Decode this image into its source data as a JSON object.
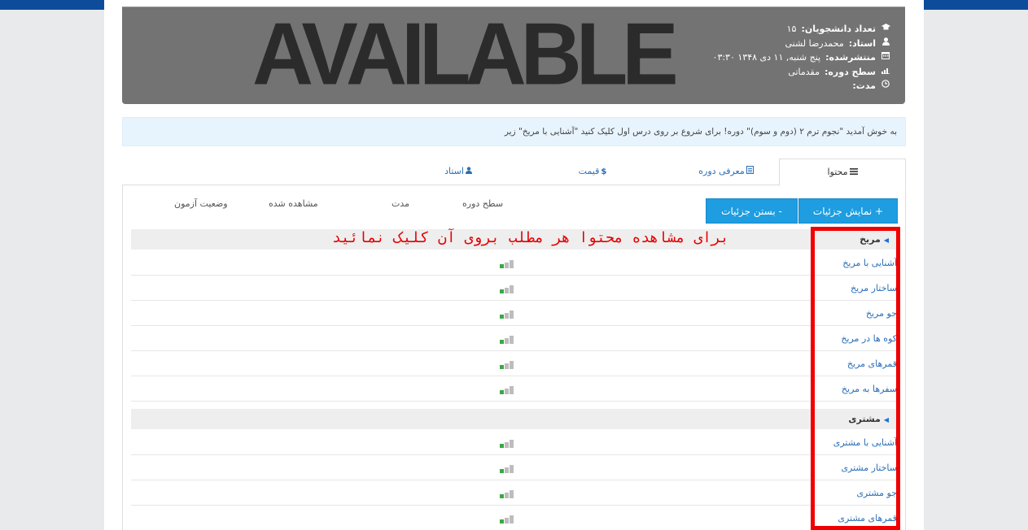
{
  "banner": {
    "image_text": "AVAILABLE",
    "info": [
      {
        "icon": "graduation-cap-icon",
        "label": "تعداد دانشجویان:",
        "value": "۱۵"
      },
      {
        "icon": "user-icon",
        "label": "استاد:",
        "value": "محمدرضا لشنی"
      },
      {
        "icon": "calendar-icon",
        "label": "منتشرشده:",
        "value": "پنج شنبه, ۱۱ دی ۱۳۴۸ ۰۳:۳۰"
      },
      {
        "icon": "level-bars-icon",
        "label": "سطح دوره:",
        "value": "مقدماتی"
      },
      {
        "icon": "clock-icon",
        "label": "مدت:",
        "value": ""
      }
    ]
  },
  "welcome_text": "به خوش آمدید \"نجوم ترم ۲ (دوم و سوم)\" دوره! برای شروع بر روی درس اول کلیک کنید \"آشنایی با مریخ\" زیر",
  "tabs": [
    {
      "label": "محتوا",
      "icon": "list-icon",
      "active": true
    },
    {
      "label": "معرفی دوره",
      "icon": "document-icon",
      "active": false
    },
    {
      "label": "قیمت",
      "icon": "dollar-icon",
      "active": false
    },
    {
      "label": "استاد",
      "icon": "user-icon",
      "active": false
    }
  ],
  "buttons": {
    "show_details": "+ نمایش جزئیات",
    "hide_details": "- بستن جزئیات"
  },
  "columns": [
    "سطح دوره",
    "مدت",
    "مشاهده شده",
    "وضعیت آزمون"
  ],
  "annotation": "برای مشاهده محتوا هر مطلب بروی آن کلیک نمائید",
  "sections": [
    {
      "title": "مریخ",
      "lessons": [
        "آشنایی با مریخ",
        "ساختار مریخ",
        "جو مریخ",
        "کوه ها در مریخ",
        "قمرهای مریخ",
        "سفرها به مریخ"
      ]
    },
    {
      "title": "مشتری",
      "lessons": [
        "آشنایی با مشتری",
        "ساختار مشتری",
        "جو مشتری",
        "قمرهای مشتری"
      ]
    }
  ],
  "colors": {
    "accent_blue": "#1e9de0",
    "header_blue": "#0d4c9b",
    "annotation_red": "#f00000",
    "level_green": "#3aa845",
    "level_gray": "#bdbdbd"
  }
}
